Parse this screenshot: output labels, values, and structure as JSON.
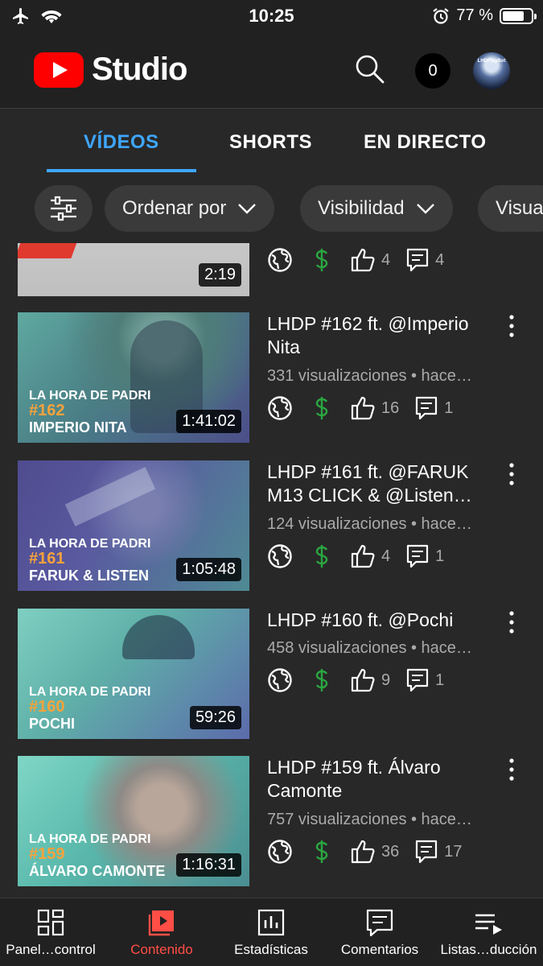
{
  "status_bar": {
    "time": "10:25",
    "battery": "77 %",
    "battery_level": 0.77,
    "icons": [
      "airplane-icon",
      "wifi-icon",
      "alarm-icon",
      "battery-icon"
    ]
  },
  "header": {
    "logo_text": "Studio",
    "notification_count": "0",
    "avatar_text": "LHDPlayBot"
  },
  "tabs": [
    {
      "label": "VÍDEOS",
      "active": true
    },
    {
      "label": "SHORTS",
      "active": false
    },
    {
      "label": "EN DIRECTO",
      "active": false
    }
  ],
  "filters": {
    "sort": "Ordenar por",
    "visibility": "Visibilidad",
    "partial": "Visua"
  },
  "videos": [
    {
      "title": "",
      "meta": "",
      "duration": "2:19",
      "likes": "4",
      "comments": "4"
    },
    {
      "title": "LHDP #162 ft. @Imperio Nita",
      "meta": "331 visualizaciones • hace…",
      "duration": "1:41:02",
      "likes": "16",
      "comments": "1",
      "thumb": {
        "line1": "LA HORA DE PADRI",
        "line2": "#162",
        "line3": "IMPERIO NITA"
      }
    },
    {
      "title": "LHDP #161 ft. @FARUK M13 CLICK  & @Listen…",
      "meta": "124 visualizaciones • hace…",
      "duration": "1:05:48",
      "likes": "4",
      "comments": "1",
      "thumb": {
        "line1": "LA HORA DE PADRI",
        "line2": "#161",
        "line3": "FARUK & LISTEN"
      }
    },
    {
      "title": "LHDP #160 ft. @Pochi",
      "meta": "458 visualizaciones • hace…",
      "duration": "59:26",
      "likes": "9",
      "comments": "1",
      "thumb": {
        "line1": "LA HORA DE PADRI",
        "line2": "#160",
        "line3": "POCHI"
      }
    },
    {
      "title": "LHDP #159 ft. Álvaro Camonte",
      "meta": "757 visualizaciones • hace…",
      "duration": "1:16:31",
      "likes": "36",
      "comments": "17",
      "thumb": {
        "line1": "LA HORA DE PADRI",
        "line2": "#159",
        "line3": "ÁLVARO CAMONTE"
      }
    }
  ],
  "bottom_nav": [
    {
      "label": "Panel…control",
      "icon": "dashboard-icon",
      "active": false
    },
    {
      "label": "Contenido",
      "icon": "content-icon",
      "active": true
    },
    {
      "label": "Estadísticas",
      "icon": "analytics-icon",
      "active": false
    },
    {
      "label": "Comentarios",
      "icon": "comments-icon",
      "active": false
    },
    {
      "label": "Listas…ducción",
      "icon": "playlists-icon",
      "active": false
    }
  ],
  "colors": {
    "accent_blue": "#3ea6ff",
    "brand_red": "#ff0000",
    "monetization_green": "#2ba640",
    "active_nav_red": "#ff4e45"
  }
}
